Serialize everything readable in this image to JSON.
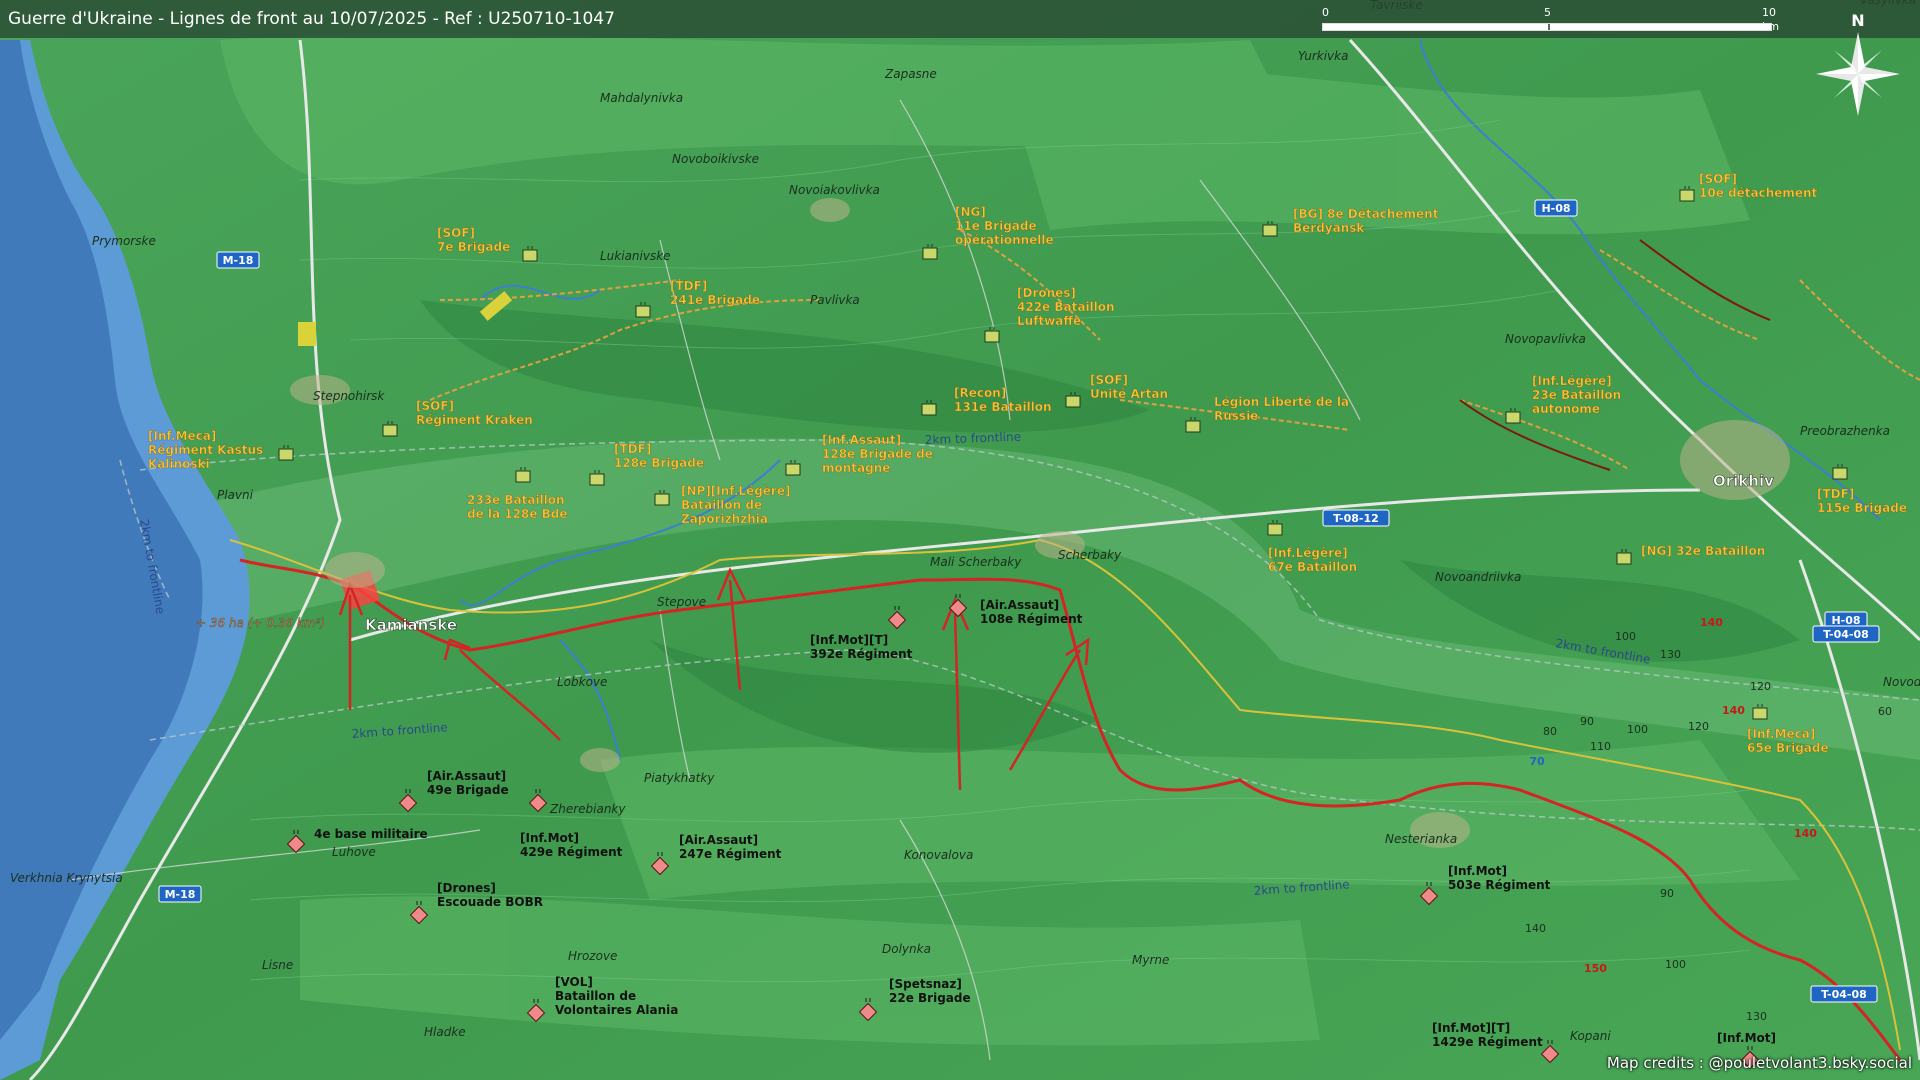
{
  "header": {
    "title": "Guerre d'Ukraine - Lignes de front au 10/07/2025 - Ref : U250710-1047"
  },
  "scale": {
    "ticks": [
      "0",
      "5",
      "10 km"
    ]
  },
  "compass": {
    "north": "N",
    "icon": "compass-rose-icon"
  },
  "credits": "Map credits : @pouletvolant3.bsky.social",
  "colors": {
    "terrain": "#3f9a4e",
    "water": "#5d9bd6",
    "front_line": "#d42424",
    "buffer_line": "#c8b23a",
    "ukr_unit": "#c9d76b",
    "rus_unit": "#f08a8a",
    "ukr_label": "#f6c23a",
    "trench": "#e0a040"
  },
  "towns": [
    {
      "id": "town-tavriiske",
      "name": "Tavriiske"
    },
    {
      "id": "town-vasylivka",
      "name": "Vasylivka"
    },
    {
      "id": "town-zapasne",
      "name": "Zapasne"
    },
    {
      "id": "town-yurkivka",
      "name": "Yurkivka"
    },
    {
      "id": "town-mahdalynivka",
      "name": "Mahdalynivka"
    },
    {
      "id": "town-novoboikivske",
      "name": "Novoboikivske"
    },
    {
      "id": "town-novoiakovlivka",
      "name": "Novoiakovlivka"
    },
    {
      "id": "town-prymorske",
      "name": "Prymorske"
    },
    {
      "id": "town-lukianivske",
      "name": "Lukianivske"
    },
    {
      "id": "town-pavlivka",
      "name": "Pavlivka"
    },
    {
      "id": "town-novopavlivka",
      "name": "Novopavlivka"
    },
    {
      "id": "town-stepnohirsk",
      "name": "Stepnohirsk"
    },
    {
      "id": "town-preobrazhenka",
      "name": "Preobrazhenka"
    },
    {
      "id": "town-orikhiv",
      "name": "Orikhiv"
    },
    {
      "id": "town-plavni",
      "name": "Plavni"
    },
    {
      "id": "town-mali-scherbaky",
      "name": "Mali Scherbaky"
    },
    {
      "id": "town-scherbaky",
      "name": "Scherbaky"
    },
    {
      "id": "town-novoandriivka",
      "name": "Novoandriivka"
    },
    {
      "id": "town-kamianske",
      "name": "Kamianske"
    },
    {
      "id": "town-stepove",
      "name": "Stepove"
    },
    {
      "id": "town-lobkove",
      "name": "Lobkove"
    },
    {
      "id": "town-novodanylivka",
      "name": "Novodanylivka"
    },
    {
      "id": "town-piatykhatky",
      "name": "Piatykhatky"
    },
    {
      "id": "town-zherebianky",
      "name": "Zherebianky"
    },
    {
      "id": "town-luhove",
      "name": "Luhove"
    },
    {
      "id": "town-verkhnia-krynytsia",
      "name": "Verkhnia Krynytsia"
    },
    {
      "id": "town-konovalova",
      "name": "Konovalova"
    },
    {
      "id": "town-nesterianka",
      "name": "Nesterianka"
    },
    {
      "id": "town-hrozove",
      "name": "Hrozove"
    },
    {
      "id": "town-dolynka",
      "name": "Dolynka"
    },
    {
      "id": "town-myrne",
      "name": "Myrne"
    },
    {
      "id": "town-lisne",
      "name": "Lisne"
    },
    {
      "id": "town-hladke",
      "name": "Hladke"
    },
    {
      "id": "town-kopani",
      "name": "Kopani"
    }
  ],
  "roads": [
    {
      "id": "road-m18-north",
      "name": "M-18"
    },
    {
      "id": "road-m18-south",
      "name": "M-18"
    },
    {
      "id": "road-h08-north",
      "name": "H-08"
    },
    {
      "id": "road-t0812",
      "name": "T-08-12"
    },
    {
      "id": "road-h08-t0408-a",
      "name": "H-08"
    },
    {
      "id": "road-h08-t0408-b",
      "name": "T-04-08"
    },
    {
      "id": "road-t0408-south",
      "name": "T-04-08"
    },
    {
      "id": "road-70",
      "name": "70"
    }
  ],
  "buffer_labels": [
    {
      "id": "buffer-label-1",
      "text": "2km to frontline"
    },
    {
      "id": "buffer-label-2",
      "text": "2km to frontline"
    },
    {
      "id": "buffer-label-3",
      "text": "2km to frontline"
    },
    {
      "id": "buffer-label-4",
      "text": "2km to frontline"
    },
    {
      "id": "buffer-label-5",
      "text": "2km to frontline"
    }
  ],
  "gain": {
    "text": "+ 36 ha (+ 0.36 km²)"
  },
  "ukr_units": [
    {
      "id": "ukr-sof-7",
      "lines": [
        "[SOF]",
        "7e Brigade"
      ]
    },
    {
      "id": "ukr-tdf-241",
      "lines": [
        "[TDF]",
        "241e Brigade"
      ]
    },
    {
      "id": "ukr-ng-11",
      "lines": [
        "[NG]",
        "11e Brigade",
        "opérationnelle"
      ]
    },
    {
      "id": "ukr-drones-422",
      "lines": [
        "[Drones]",
        "422e Bataillon",
        "Luftwaffe"
      ]
    },
    {
      "id": "ukr-bg-8",
      "lines": [
        "[BG] 8e Détachement",
        "Berdyansk"
      ]
    },
    {
      "id": "ukr-sof-10",
      "lines": [
        "[SOF]",
        "10e détachement"
      ]
    },
    {
      "id": "ukr-sof-kraken",
      "lines": [
        "[SOF]",
        "Régiment Kraken"
      ]
    },
    {
      "id": "ukr-recon-131",
      "lines": [
        "[Recon]",
        "131e Bataillon"
      ]
    },
    {
      "id": "ukr-sof-artan",
      "lines": [
        "[SOF]",
        "Unité Artan"
      ]
    },
    {
      "id": "ukr-legion",
      "lines": [
        "Légion Liberté de la",
        "Russie"
      ]
    },
    {
      "id": "ukr-infleg-23",
      "lines": [
        "[Inf.Légère]",
        "23e Bataillon",
        "autonome"
      ]
    },
    {
      "id": "ukr-infmeca-kalinoski",
      "lines": [
        "[Inf.Meca]",
        "Régiment Kastus",
        "Kalinoski"
      ]
    },
    {
      "id": "ukr-tdf-128",
      "lines": [
        "[TDF]",
        "128e Brigade"
      ]
    },
    {
      "id": "ukr-infassaut-128",
      "lines": [
        "[Inf.Assaut]",
        "128e Brigade de",
        "montagne"
      ]
    },
    {
      "id": "ukr-233",
      "lines": [
        "233e Bataillon",
        "de la 128e Bde"
      ]
    },
    {
      "id": "ukr-np-zaporizhzhia",
      "lines": [
        "[NP][Inf.Légère]",
        "Bataillon de",
        "Zaporizhzhia"
      ]
    },
    {
      "id": "ukr-infleg-67",
      "lines": [
        "[Inf.Légère]",
        "67e Bataillon"
      ]
    },
    {
      "id": "ukr-ng-32",
      "lines": [
        "[NG] 32e Bataillon"
      ]
    },
    {
      "id": "ukr-tdf-115",
      "lines": [
        "[TDF]",
        "115e Brigade"
      ]
    },
    {
      "id": "ukr-infmeca-65",
      "lines": [
        "[Inf.Meca]",
        "65e Brigade"
      ]
    }
  ],
  "rus_units": [
    {
      "id": "rus-airassaut-108",
      "lines": [
        "[Air.Assaut]",
        "108e Régiment"
      ]
    },
    {
      "id": "rus-infmot-392",
      "lines": [
        "[Inf.Mot][T]",
        "392e Régiment"
      ]
    },
    {
      "id": "rus-airassaut-49",
      "lines": [
        "[Air.Assaut]",
        "49e Brigade"
      ]
    },
    {
      "id": "rus-base-4",
      "lines": [
        "4e base militaire"
      ]
    },
    {
      "id": "rus-infmot-429",
      "lines": [
        "[Inf.Mot]",
        "429e Régiment"
      ]
    },
    {
      "id": "rus-airassaut-247",
      "lines": [
        "[Air.Assaut]",
        "247e Régiment"
      ]
    },
    {
      "id": "rus-drones-bobr",
      "lines": [
        "[Drones]",
        "Escouade BOBR"
      ]
    },
    {
      "id": "rus-infmot-503",
      "lines": [
        "[Inf.Mot]",
        "503e Régiment"
      ]
    },
    {
      "id": "rus-vol-alania",
      "lines": [
        "[VOL]",
        "Bataillon de",
        "Volontaires Alania"
      ]
    },
    {
      "id": "rus-spetsnaz-22",
      "lines": [
        "[Spetsnaz]",
        "22e Brigade"
      ]
    },
    {
      "id": "rus-infmot-1429",
      "lines": [
        "[Inf.Mot][T]",
        "1429e Régiment"
      ]
    },
    {
      "id": "rus-infmot-extra",
      "lines": [
        "[Inf.Mot]"
      ]
    }
  ],
  "elevation_labels": [
    {
      "id": "elev-140-a",
      "text": "140"
    },
    {
      "id": "elev-130-a",
      "text": "130"
    },
    {
      "id": "elev-100-a",
      "text": "100"
    },
    {
      "id": "elev-120-a",
      "text": "120"
    },
    {
      "id": "elev-140-b",
      "text": "140"
    },
    {
      "id": "elev-80",
      "text": "80"
    },
    {
      "id": "elev-90-a",
      "text": "90"
    },
    {
      "id": "elev-100-b",
      "text": "100"
    },
    {
      "id": "elev-120-b",
      "text": "120"
    },
    {
      "id": "elev-110",
      "text": "110"
    },
    {
      "id": "elev-60",
      "text": "60"
    },
    {
      "id": "elev-140-c",
      "text": "140"
    },
    {
      "id": "elev-90-b",
      "text": "90"
    },
    {
      "id": "elev-140-d",
      "text": "140"
    },
    {
      "id": "elev-150",
      "text": "150"
    },
    {
      "id": "elev-100-c",
      "text": "100"
    },
    {
      "id": "elev-130-b",
      "text": "130"
    }
  ]
}
